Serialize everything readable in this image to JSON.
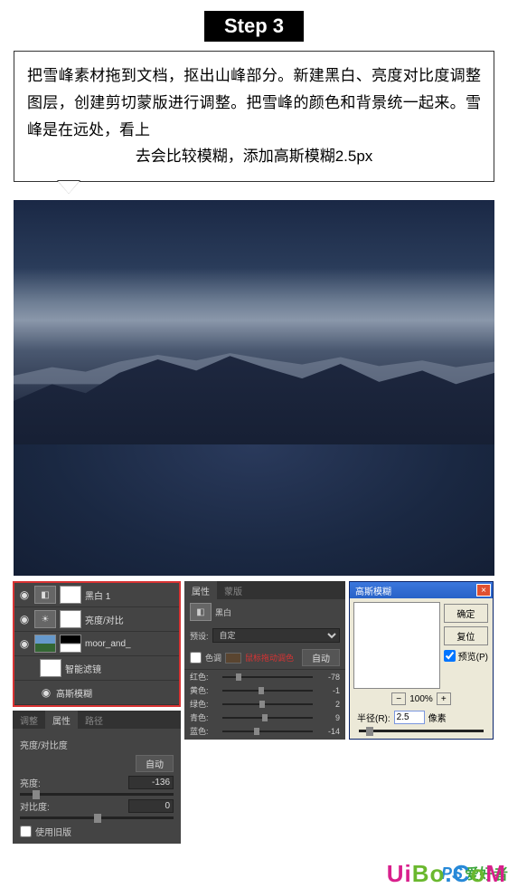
{
  "step": {
    "badge": "Step 3",
    "description_main": "把雪峰素材拖到文档，抠出山峰部分。新建黑白、亮度对比度调整图层，创建剪切蒙版进行调整。把雪峰的颜色和背景统一起来。雪峰是在远处，看上",
    "description_last": "去会比较模糊，添加高斯模糊2.5px"
  },
  "layers": {
    "blackwhite": "黑白 1",
    "brightness": "亮度/对比",
    "smart_object": "moor_and_",
    "smart_filters": "智能滤镜",
    "gaussian_blur": "高斯模糊"
  },
  "brightness_panel": {
    "tab1": "调整",
    "tab2": "属性",
    "tab3": "路径",
    "title": "亮度/对比度",
    "auto": "自动",
    "brightness_label": "亮度:",
    "brightness_value": "-136",
    "contrast_label": "对比度:",
    "contrast_value": "0",
    "legacy": "使用旧版"
  },
  "bw_panel": {
    "tab_props": "属性",
    "tab_mask": "蒙版",
    "title": "黑白",
    "preset_label": "预设:",
    "preset_value": "自定",
    "tint_label": "色调",
    "red_hint": "鼠标拖动调色",
    "auto": "自动",
    "red": "红色:",
    "red_v": "-78",
    "yellow": "黄色:",
    "yellow_v": "-1",
    "green": "绿色:",
    "green_v": "2",
    "cyan": "青色:",
    "cyan_v": "9",
    "blue": "蓝色:",
    "blue_v": "-14"
  },
  "blur_dialog": {
    "title": "高斯模糊",
    "ok": "确定",
    "cancel": "复位",
    "preview": "预览(P)",
    "zoom": "100%",
    "radius_label": "半径(R):",
    "radius_value": "2.5",
    "radius_unit": "像素"
  },
  "watermark": {
    "ps": "PS",
    "chinese": "爱好者",
    "u": "U",
    "i": "i",
    "b1": "B",
    "o": "o",
    "dot": ".",
    "c": "C",
    "o2": "o",
    "m": "M"
  }
}
